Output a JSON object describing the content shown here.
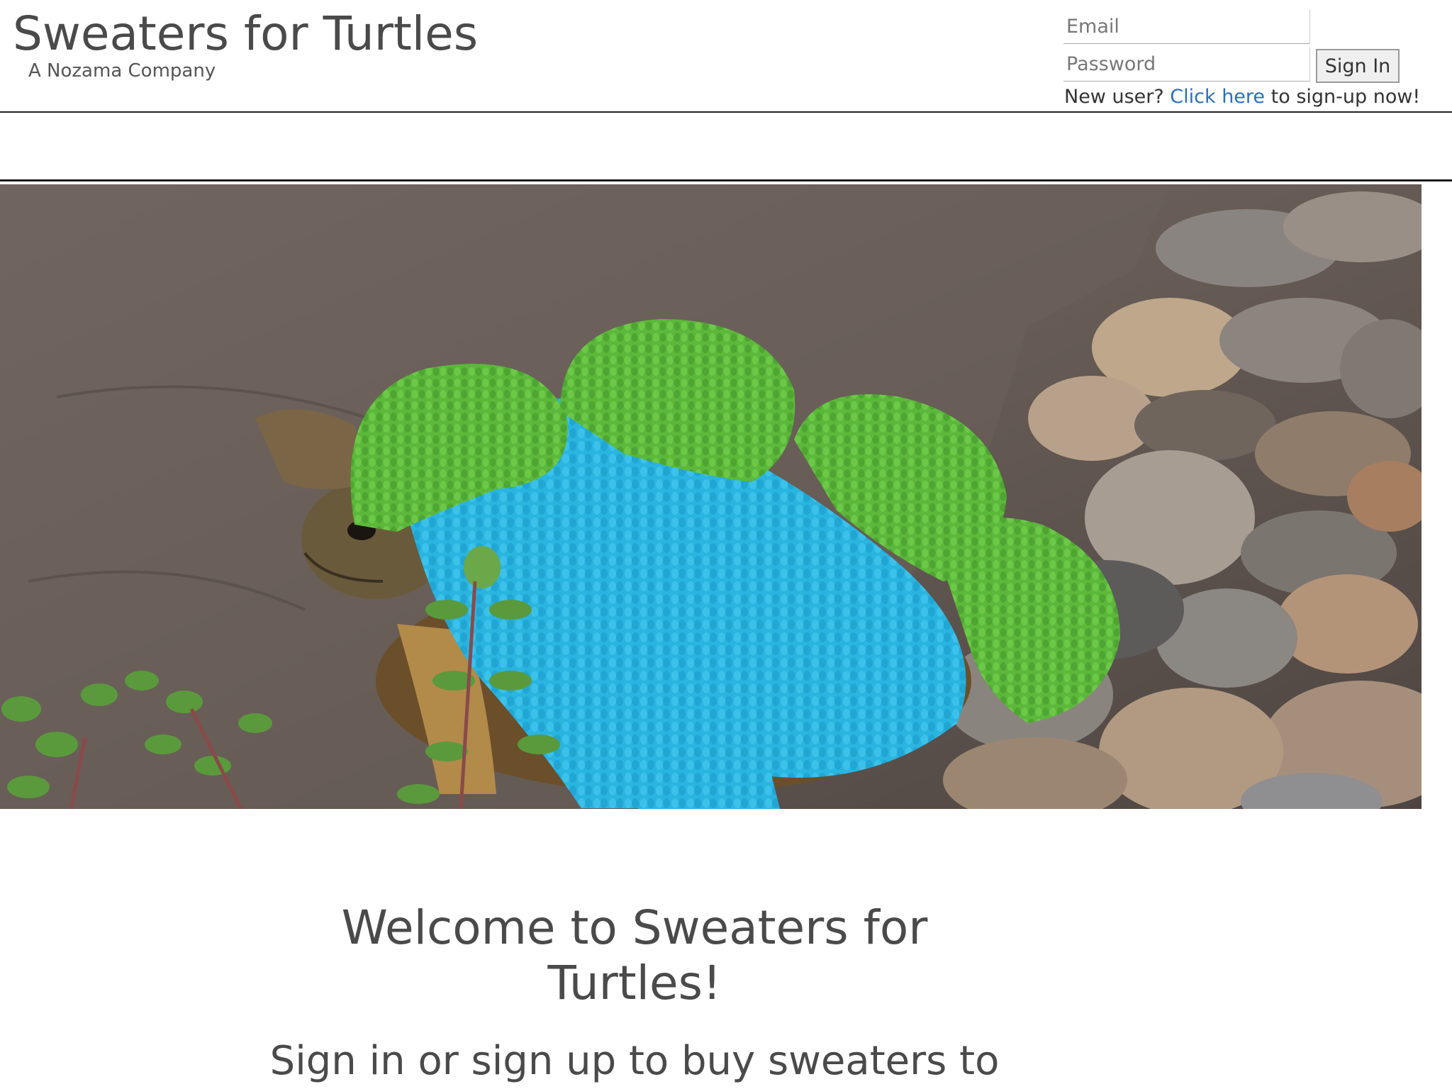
{
  "header": {
    "title": "Sweaters for Turtles",
    "tagline": "A Nozama Company"
  },
  "login": {
    "email_placeholder": "Email",
    "password_placeholder": "Password",
    "signin_label": "Sign In",
    "signup_prefix": "New user? ",
    "signup_link": "Click here",
    "signup_suffix": " to sign-up now!"
  },
  "hero": {
    "image_subject": "turtle-in-crocheted-dinosaur-sweater"
  },
  "main": {
    "welcome_heading": "Welcome to Sweaters for Turtles!",
    "subtext": "Sign in or sign up to buy sweaters to"
  },
  "colors": {
    "link": "#2a6fb8",
    "text": "#4a4a4a",
    "sweater_blue": "#2ab4e0",
    "sweater_green": "#5cb83a"
  }
}
